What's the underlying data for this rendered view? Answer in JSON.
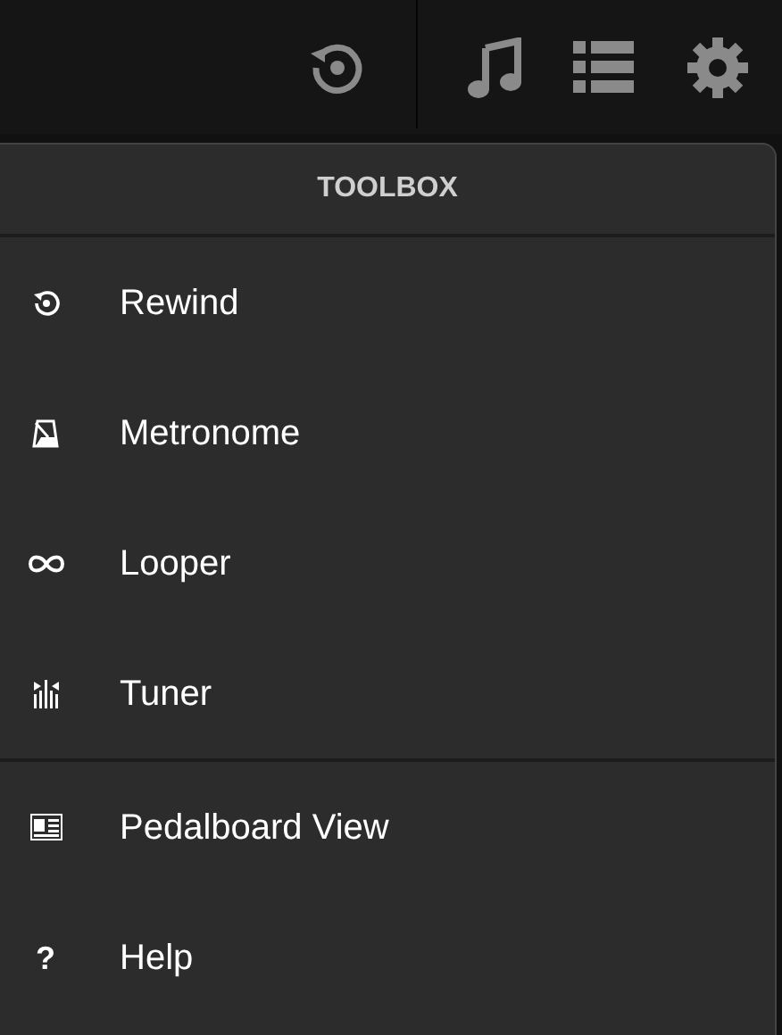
{
  "toolbar": {
    "buttons": [
      {
        "kind": "rewind"
      },
      {
        "kind": "music"
      },
      {
        "kind": "list"
      },
      {
        "kind": "settings"
      }
    ]
  },
  "menu": {
    "title": "TOOLBOX",
    "groups": [
      [
        {
          "label": "Rewind",
          "kind": "rewind"
        },
        {
          "label": "Metronome",
          "kind": "metronome"
        },
        {
          "label": "Looper",
          "kind": "looper"
        },
        {
          "label": "Tuner",
          "kind": "tuner"
        }
      ],
      [
        {
          "label": "Pedalboard View",
          "kind": "pedalboard"
        },
        {
          "label": "Help",
          "kind": "glyph",
          "glyph": "?"
        }
      ]
    ]
  }
}
